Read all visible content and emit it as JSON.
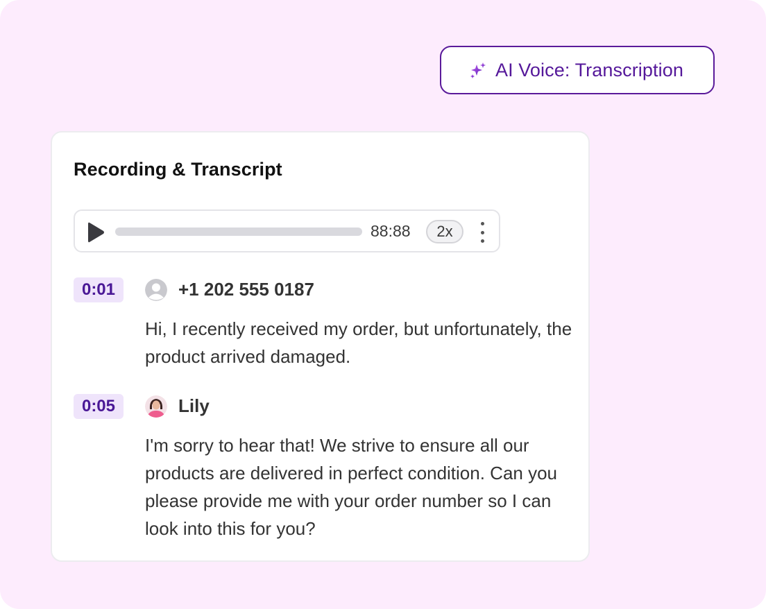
{
  "badge": {
    "label": "AI Voice: Transcription",
    "icon": "sparkles-icon",
    "accent_color": "#55189a"
  },
  "card": {
    "title": "Recording & Transcript",
    "player": {
      "play_icon": "play-icon",
      "progress": 0,
      "duration": "88:88",
      "speed": "2x",
      "more_icon": "more-vertical-icon"
    },
    "transcript": [
      {
        "time": "0:01",
        "speaker": "+1 202 555 0187",
        "avatar": "default-user-icon",
        "text": "Hi, I recently received my order, but unfortunately, the product arrived damaged."
      },
      {
        "time": "0:05",
        "speaker": "Lily",
        "avatar": "agent-photo",
        "text": "I'm sorry to hear that! We strive to ensure all our products are delivered in perfect condition. Can you please provide me with your order number so I can look into this for you?"
      }
    ]
  },
  "colors": {
    "background": "#fdecfd",
    "timestamp_bg": "#efe4fb",
    "timestamp_text": "#4a1896"
  }
}
